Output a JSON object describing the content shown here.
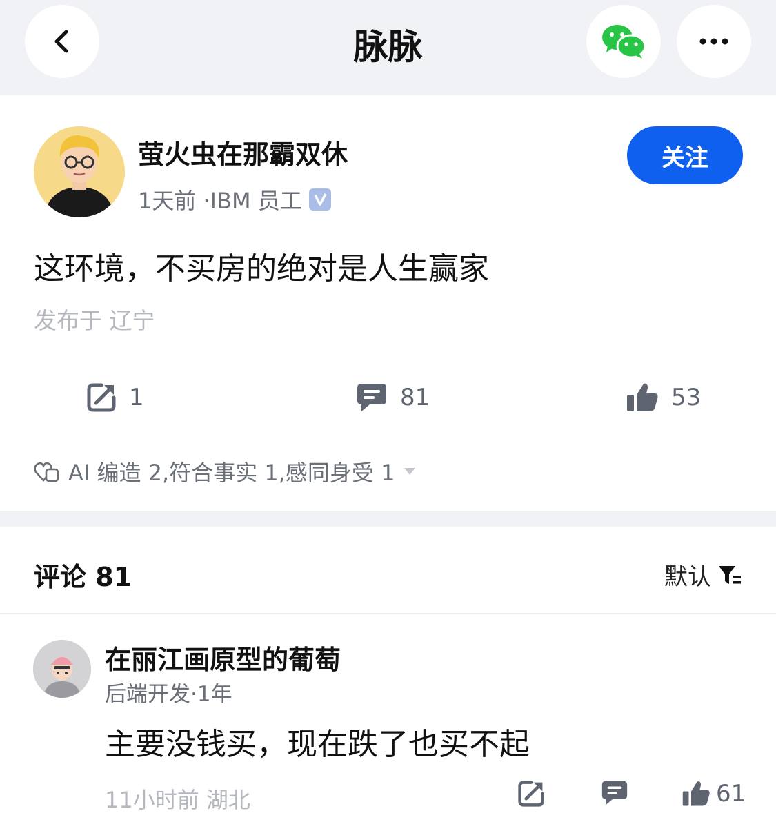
{
  "header": {
    "title": "脉脉",
    "back_icon": "chevron-left-icon",
    "share_icon": "wechat-icon",
    "more_icon": "more-icon"
  },
  "post": {
    "author": {
      "name": "萤火虫在那霸双休",
      "time": "1天前",
      "company": "·IBM 员工"
    },
    "follow_label": "关注",
    "text": "这环境，不买房的绝对是人生赢家",
    "location": "发布于 辽宁",
    "stats": {
      "share_count": "1",
      "comment_count": "81",
      "like_count": "53"
    },
    "reactions": "AI 编造 2,符合事实 1,感同身受 1"
  },
  "comments": {
    "title": "评论 81",
    "sort_label": "默认",
    "items": [
      {
        "name": "在丽江画原型的葡萄",
        "meta": "后端开发·1年",
        "text": "主要没钱买，现在跌了也买不起",
        "time": "11小时前  湖北",
        "like_count": "61"
      }
    ]
  },
  "colors": {
    "accent": "#1060f0",
    "wechat_green": "#28c445",
    "muted": "#b5b8bf",
    "band": "#f1f2f5"
  }
}
